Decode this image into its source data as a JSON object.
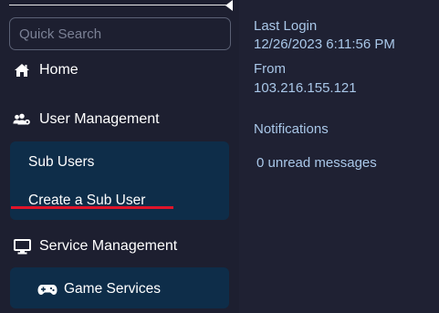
{
  "sidebar": {
    "search": {
      "placeholder": "Quick Search",
      "value": ""
    },
    "home": {
      "label": "Home",
      "icon": "home-icon"
    },
    "user_management": {
      "label": "User Management",
      "icon": "users-gear-icon",
      "items": [
        {
          "label": "Sub Users"
        },
        {
          "label": "Create a Sub User"
        }
      ]
    },
    "service_management": {
      "label": "Service Management",
      "icon": "monitor-icon",
      "items": [
        {
          "label": "Game Services",
          "icon": "gamepad-icon"
        }
      ]
    }
  },
  "info": {
    "last_login_label": "Last Login",
    "last_login_value": "12/26/2023 6:11:56 PM",
    "from_label": "From",
    "from_value": "103.216.155.121",
    "notifications_label": "Notifications",
    "notifications_value": "0 unread messages"
  },
  "colors": {
    "sidebar_bg": "#1d1f30",
    "submenu_bg": "#0e2d49",
    "info_text": "#a9c7e8",
    "highlight_underline": "#e0142a"
  }
}
